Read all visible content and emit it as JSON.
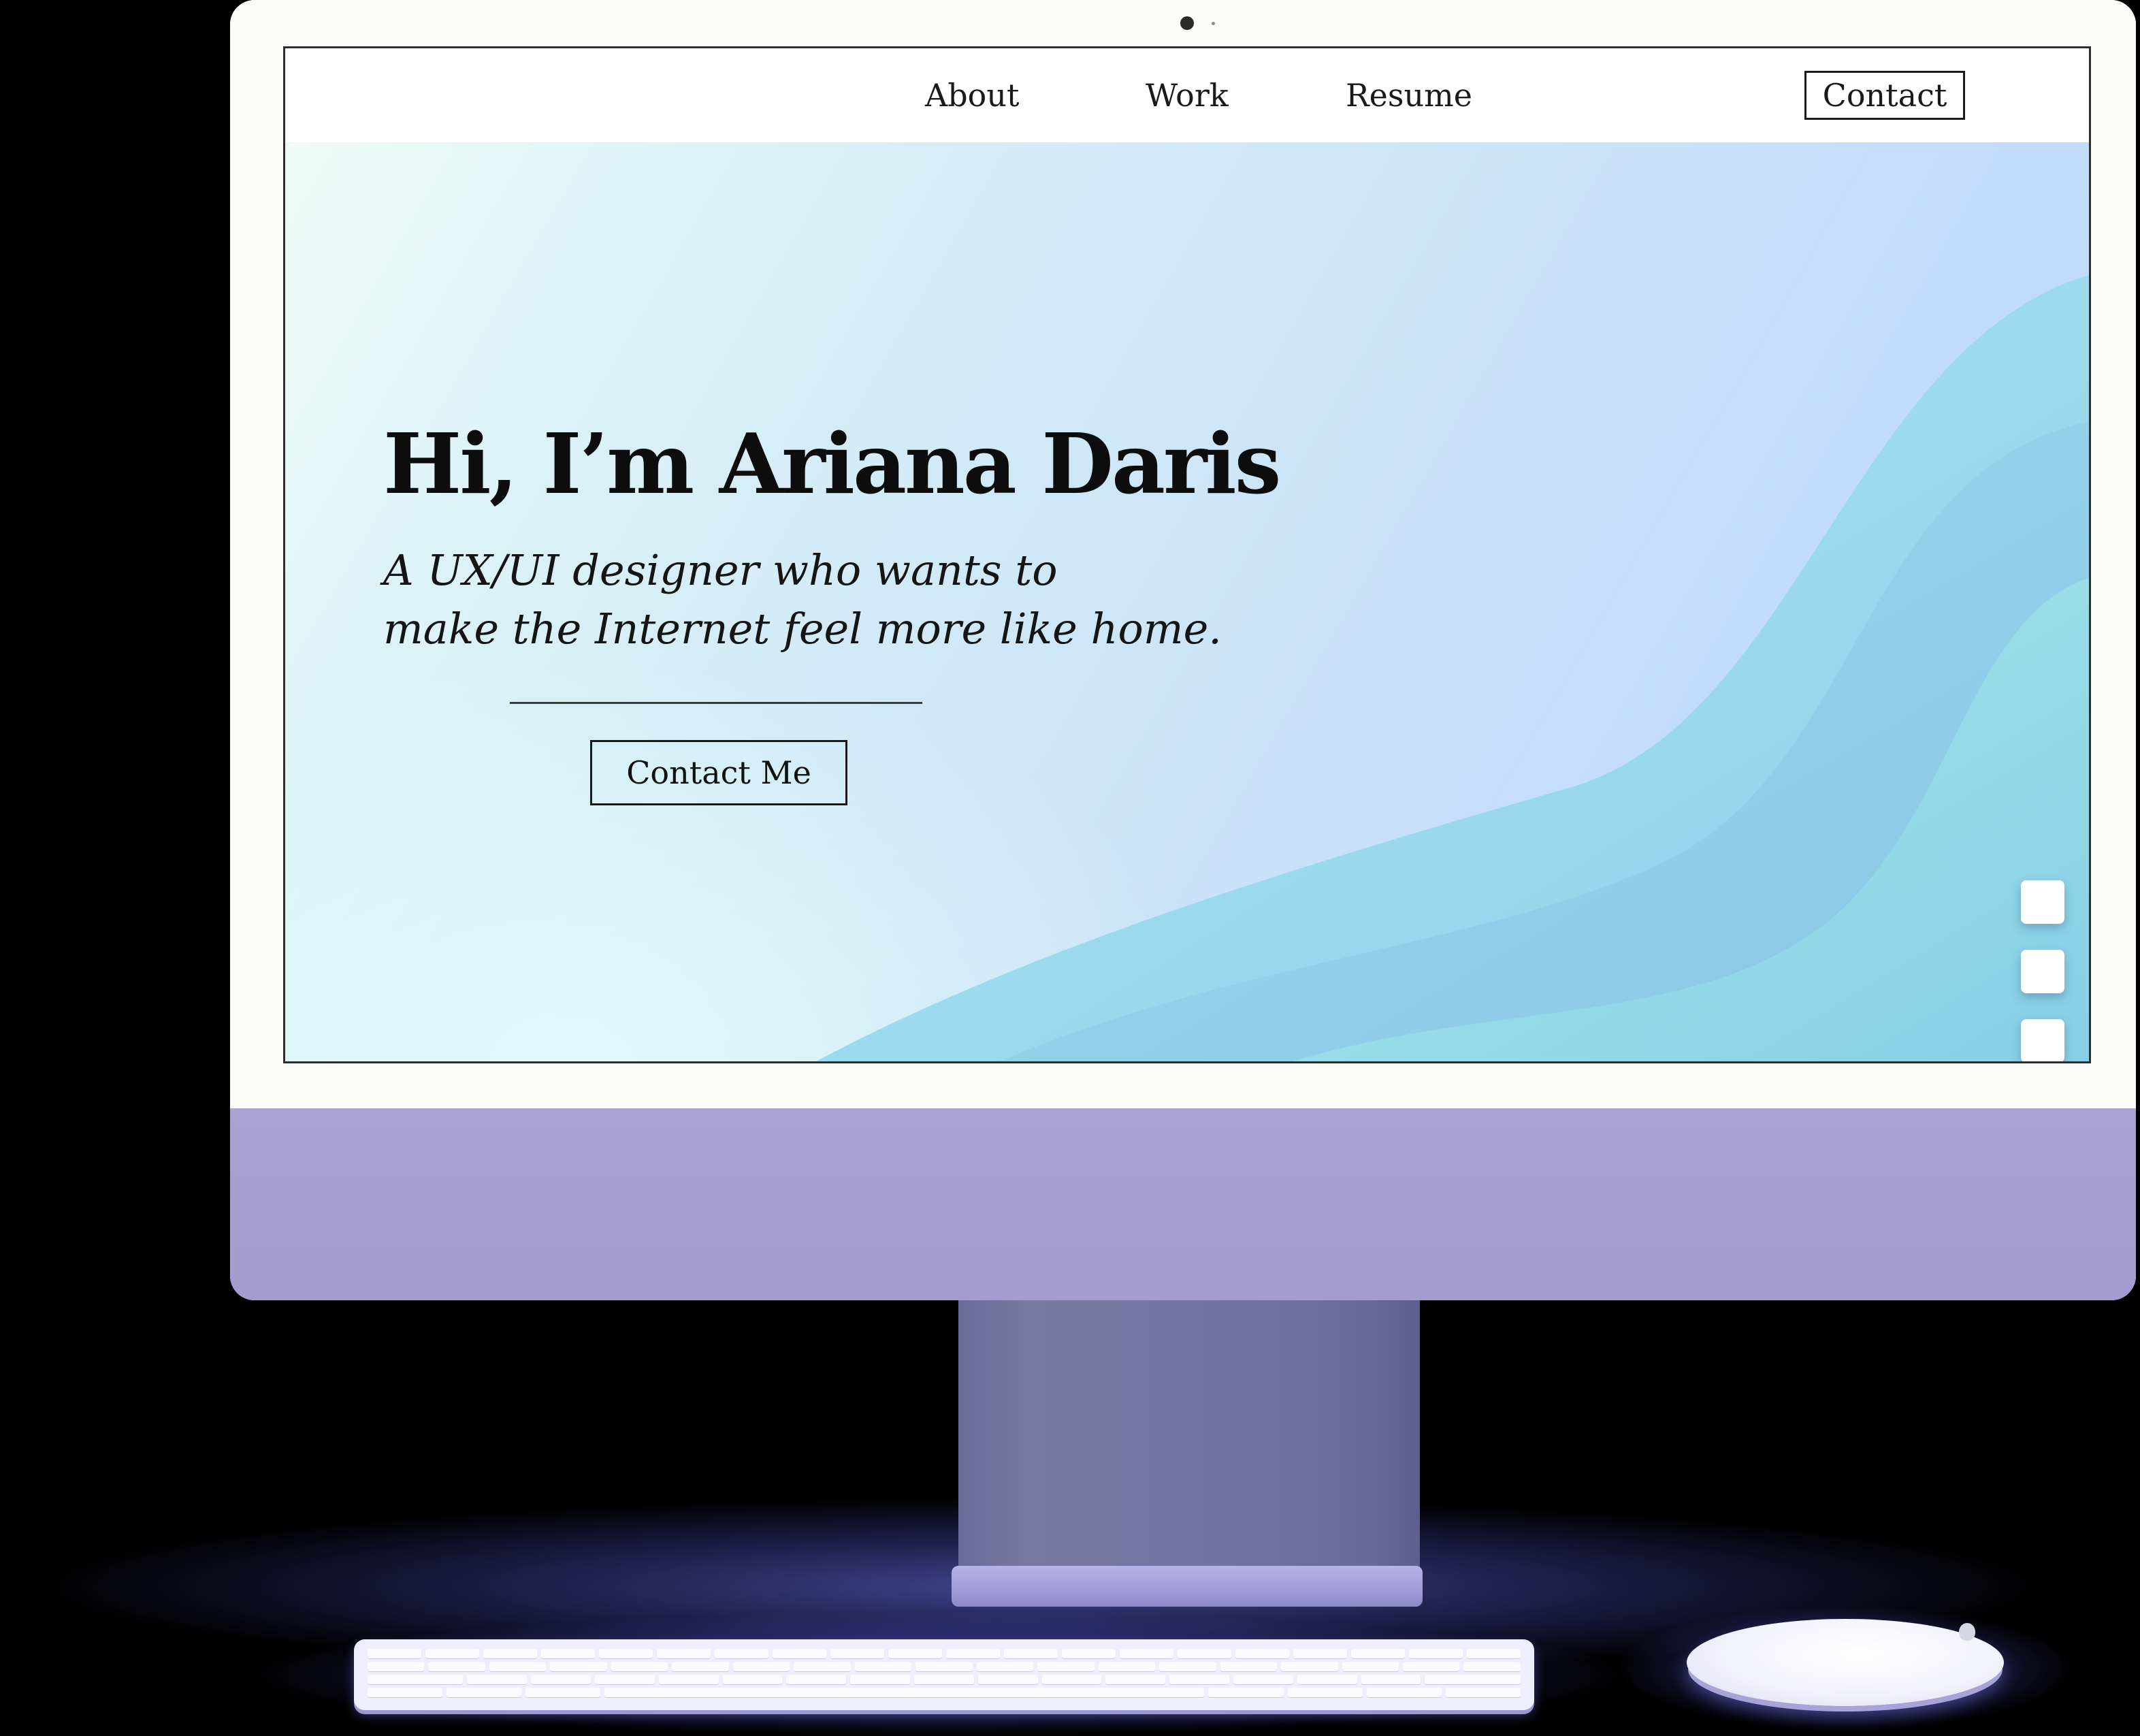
{
  "nav": {
    "about": "About",
    "work": "Work",
    "resume": "Resume",
    "contact": "Contact"
  },
  "hero": {
    "title": "Hi, I’m Ariana Daris",
    "subtitle_line1": "A UX/UI designer who wants to",
    "subtitle_line2": "make the Internet feel more like home.",
    "cta": "Contact Me"
  },
  "section_indicators": [
    {
      "icon": "page-dot"
    },
    {
      "icon": "page-dot"
    },
    {
      "icon": "page-dot"
    }
  ],
  "colors": {
    "monitor_chin": "#a8a0d0",
    "stand": "#7474a2",
    "screen_gradient_start": "#eefcf6",
    "screen_gradient_end": "#b8d6fc",
    "wave_teal": "#9fe3ea",
    "wave_blue": "#8ccbec"
  },
  "icons": {
    "camera": "camera-icon",
    "mouse_logo": "apple-logo-icon"
  }
}
